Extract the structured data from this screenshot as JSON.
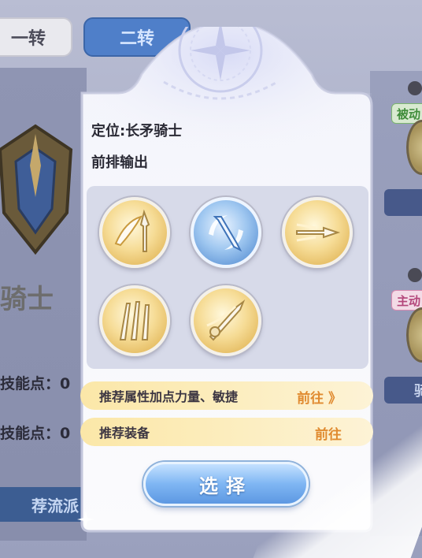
{
  "tabs": [
    {
      "label": "一转"
    },
    {
      "label": "二转"
    }
  ],
  "background": {
    "class_name": "骑士",
    "skill_points_label_1": "技能点：0",
    "skill_points_label_2": "技能点：0",
    "school_button": "荐流派",
    "tag_passive": "被动",
    "tag_active": "主动",
    "right_bar_text": "骑"
  },
  "card": {
    "role": "定位:长矛骑士",
    "description": "前排输出",
    "skills": [
      {
        "icon": "spear-wing-skill-icon",
        "style": "gold"
      },
      {
        "icon": "spear-whirl-skill-icon",
        "style": "blue",
        "selected": true
      },
      {
        "icon": "spear-thrust-skill-icon",
        "style": "gold"
      },
      {
        "icon": "triple-spear-skill-icon",
        "style": "gold"
      },
      {
        "icon": "spear-charge-skill-icon",
        "style": "gold"
      }
    ],
    "recommend_stats": {
      "label": "推荐属性加点力量、敏捷",
      "go": "前往 》"
    },
    "recommend_gear": {
      "label": "推荐装备",
      "go": "前往"
    },
    "select_button": "选择"
  },
  "colors": {
    "accent_blue": "#5d98e2",
    "gold": "#e2b75a",
    "go_orange": "#e08a2f"
  }
}
